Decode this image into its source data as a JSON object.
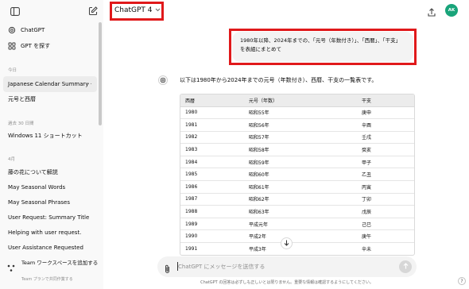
{
  "sidebar": {
    "items_top": [
      {
        "label": "ChatGPT",
        "icon": "chatgpt-logo-icon"
      },
      {
        "label": "GPT を探す",
        "icon": "grid-icon"
      }
    ],
    "sections": [
      {
        "title": "今日",
        "items": [
          "Japanese Calendar Summary",
          "元号と西暦"
        ]
      },
      {
        "title": "過去 30 日間",
        "items": [
          "Windows 11 ショートカット"
        ]
      },
      {
        "title": "4月",
        "items": [
          "藤の花について解説",
          "May Seasonal Words",
          "May Seasonal Phrases",
          "User Request: Summary Title",
          "Helping with user request.",
          "User Assistance Requested"
        ]
      }
    ],
    "active_more": "···",
    "team": {
      "title": "Team ワークスペースを追加する",
      "subtitle": "Team プランで共同作業する"
    }
  },
  "header": {
    "model": "ChatGPT 4",
    "avatar_initials": "AK"
  },
  "conversation": {
    "user_message": "1980年以降、2024年までの、「元号（年数付き）」、「西暦」、「干支」を表組にまとめて",
    "assistant_intro": "以下は1980年から2024年までの元号（年数付き）、西暦、干支の一覧表です。",
    "table": {
      "headers": [
        "西暦",
        "元号（年数）",
        "干支"
      ],
      "rows": [
        [
          "1980",
          "昭和55年",
          "庚申"
        ],
        [
          "1981",
          "昭和56年",
          "辛酉"
        ],
        [
          "1982",
          "昭和57年",
          "壬戌"
        ],
        [
          "1983",
          "昭和58年",
          "癸亥"
        ],
        [
          "1984",
          "昭和59年",
          "甲子"
        ],
        [
          "1985",
          "昭和60年",
          "乙丑"
        ],
        [
          "1986",
          "昭和61年",
          "丙寅"
        ],
        [
          "1987",
          "昭和62年",
          "丁卯"
        ],
        [
          "1988",
          "昭和63年",
          "戊辰"
        ],
        [
          "1989",
          "平成元年",
          "己巳"
        ],
        [
          "1990",
          "平成2年",
          "庚午"
        ],
        [
          "1991",
          "平成3年",
          "辛未"
        ]
      ]
    }
  },
  "composer": {
    "placeholder": "ChatGPT にメッセージを送信する",
    "disclaimer": "ChatGPT の回答は必ずしも正しいとは限りません。重要な情報は確認するようにしてください。",
    "help": "?"
  },
  "colors": {
    "highlight": "#e0191b",
    "avatar": "#19a47a"
  }
}
